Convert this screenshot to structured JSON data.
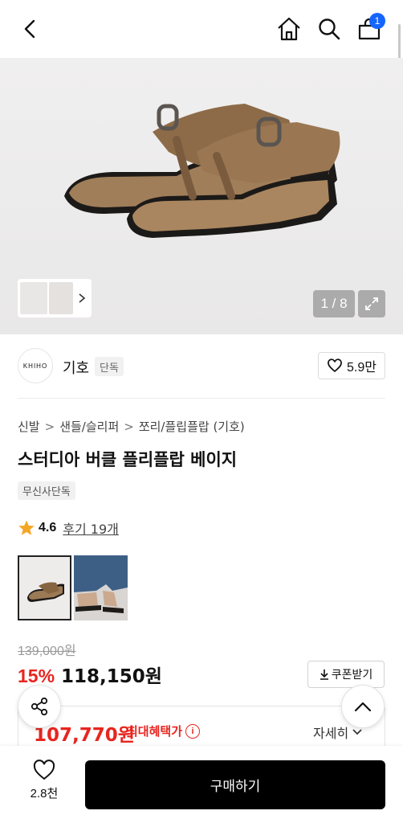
{
  "header": {
    "cart_count": "1",
    "icons": [
      "back-icon",
      "home-icon",
      "search-icon",
      "shopping-bag-icon"
    ]
  },
  "gallery": {
    "counter": "1 / 8"
  },
  "brand": {
    "logo_text": "KHIHO",
    "name": "기호",
    "tag": "단독",
    "likes": "5.9만"
  },
  "breadcrumb": [
    "신발",
    "샌들/슬리퍼",
    "쪼리/플립플랍 (기호)"
  ],
  "product": {
    "title": "스터디아 버클 플리플랍 베이지",
    "exclusive_badge": "무신사단독",
    "rating": "4.6",
    "reviews": "후기 19개"
  },
  "pricing": {
    "original": "139,000원",
    "discount": "15%",
    "sale": "118,150원",
    "coupon_label": "쿠폰받기",
    "max_benefit_price": "107,770원",
    "max_benefit_label": "최대혜택가",
    "details_label": "자세히"
  },
  "bottom_bar": {
    "wish_count": "2.8천",
    "buy_label": "구매하기"
  },
  "colors": {
    "accent_red": "#e8251f",
    "badge_blue": "#1565ff",
    "star": "#f5a623"
  }
}
